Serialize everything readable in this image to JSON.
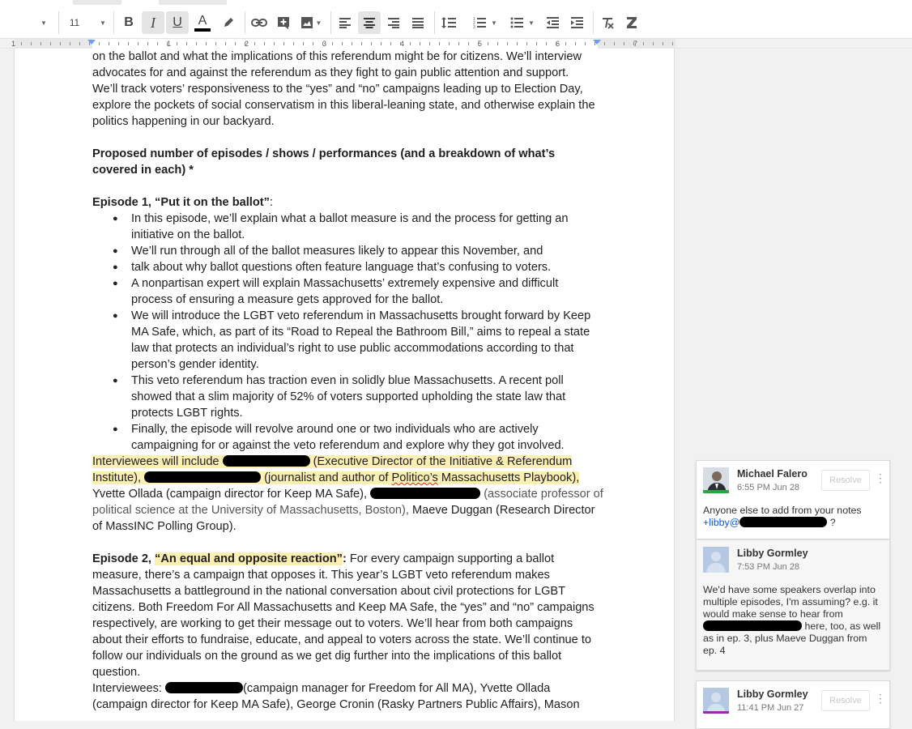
{
  "toolbar": {
    "font_size": "11",
    "bold_label": "B",
    "italic_label": "I",
    "underline_label": "U",
    "text_color_label": "A"
  },
  "ruler": {
    "numbers": [
      "1",
      "1",
      "2",
      "3",
      "4",
      "5",
      "6",
      "7"
    ]
  },
  "document": {
    "intro_lines": [
      "on the ballot and what the implications of this referendum might be for citizens. We’ll interview",
      "advocates for and against the referendum as they fight to gain public attention and support.",
      "We’ll track voters’ responsiveness to the “yes” and “no” campaigns leading up to Election Day,",
      "explore the pockets of social conservatism in this liberal-leaning state, and otherwise explain the",
      "politics happening in our backyard."
    ],
    "section_heading": "Proposed number of episodes / shows / performances (and a breakdown of what’s covered in each) *",
    "ep1_title": "Episode 1, “Put it on the ballot”",
    "ep1_colon": ":",
    "ep1_bullets": [
      "In this episode, we’ll explain what a ballot measure is and the process for getting an initiative on the ballot.",
      "We’ll run through all of the ballot measures likely to appear this November, and",
      "talk about why ballot questions often feature language that’s confusing to voters.",
      "A nonpartisan expert will explain Massachusetts’ extremely expensive and difficult process of ensuring a measure gets approved for the ballot.",
      "We will introduce the LGBT veto referendum in Massachusetts brought forward by Keep MA Safe, which, as part of its “Road to Repeal the Bathroom Bill,” aims to repeal a state law that protects an individual’s right to use public accommodations according to that person’s gender identity.",
      "This veto referendum has traction even in solidly blue Massachusetts. A recent poll showed that a slim majority of 52% of voters supported upholding the state law that protects LGBT rights.",
      "Finally, the episode will revolve around one or two individuals who are actively campaigning for or against the veto referendum and explore why they got involved."
    ],
    "ep1_interviewees": {
      "part1": "Interviewees will include",
      "part2": " (Executive Director of the Initiative & Referendum Institute),",
      "part3": " (journalist and author of ",
      "part3b": "Politico’s",
      "part3c": " Massachusetts Playbook),",
      "part4": " Yvette Ollada (campaign director for Keep MA Safe),",
      "part5": " (associate professor of political science at the University of Massachusetts, Boston),",
      "part6": " Maeve Duggan (Research Director of MassINC Polling Group)."
    },
    "ep2_title": "Episode 2, ",
    "ep2_quote": "“An equal and opposite reaction”",
    "ep2_colon": ":",
    "ep2_body": " For every campaign supporting a ballot measure, there’s a campaign that opposes it. This year’s LGBT veto referendum makes Massachusetts a battleground in the national conversation about civil protections for LGBT citizens. Both Freedom For All Massachusetts and Keep MA Safe, the “yes” and “no” campaigns respectively, are working to get their message out to voters. We’ll hear from both campaigns about their efforts to fundraise, educate, and appeal to voters across the state. We’ll continue to follow our individuals on the ground as we get dig further into the implications of this ballot question.",
    "ep2_interviewees_label": "Interviewees: ",
    "ep2_interviewees_rest": "(campaign manager for Freedom for All MA), Yvette Ollada (campaign director for Keep MA Safe), George Cronin (Rasky Partners Public Affairs), Mason"
  },
  "comments": [
    {
      "author": "Michael Falero",
      "time": "6:55 PM Jun 28",
      "resolve_label": "Resolve",
      "body_line1": "Anyone else to add from your notes",
      "body_prefix": "+libby@",
      "body_suffix": " ?"
    },
    {
      "author": "Libby Gormley",
      "time": "7:53 PM Jun 28",
      "body_a": "We'd have some speakers overlap into multiple episodes, I'm assuming? e.g. it would make sense to hear from",
      "body_b": "here, too, as well as in ep. 3, plus Maeve Duggan from ep. 4"
    },
    {
      "author": "Libby Gormley",
      "time": "11:41 PM Jun 27",
      "resolve_label": "Resolve"
    }
  ],
  "colors": {
    "highlight": "#fcefb4",
    "link": "#1155cc",
    "ruler_indent": "#6b9df5"
  }
}
